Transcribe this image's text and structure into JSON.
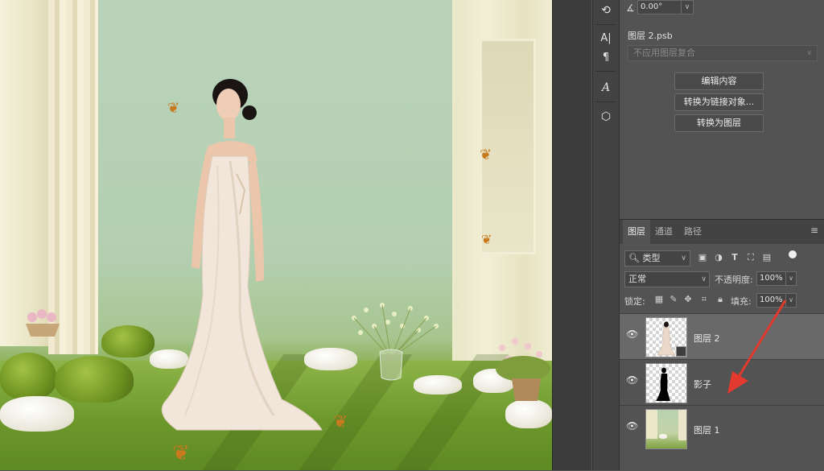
{
  "toolstrip": {
    "tools": [
      "history-icon",
      "character-icon",
      "paragraph-icon",
      "glyphs-icon",
      "3d-icon"
    ]
  },
  "properties": {
    "angle": "0.00°",
    "linked_layer_name": "图层 2.psb",
    "layer_comp_placeholder": "不应用图层复合",
    "buttons": {
      "edit_contents": "编辑内容",
      "convert_to_linked": "转换为链接对象...",
      "convert_to_layers": "转换为图层"
    }
  },
  "layers_panel": {
    "tabs": [
      "图层",
      "通道",
      "路径"
    ],
    "active_tab": "图层",
    "filter": {
      "kind_label": "类型",
      "icons": [
        "image-filter-icon",
        "adjustment-filter-icon",
        "type-filter-icon",
        "shape-filter-icon",
        "smart-object-filter-icon"
      ]
    },
    "blend_mode": "正常",
    "opacity_label": "不透明度:",
    "opacity": "100%",
    "lock_label": "锁定:",
    "fill_label": "填充:",
    "fill": "100%",
    "layers": [
      {
        "name": "图层 2",
        "selected": true,
        "visible": true,
        "type": "smart-object"
      },
      {
        "name": "影子",
        "selected": false,
        "visible": true,
        "type": "pixel"
      },
      {
        "name": "图层 1",
        "selected": false,
        "visible": true,
        "type": "pixel"
      }
    ]
  },
  "colors": {
    "panel_bg": "#535353",
    "selected_row": "#696969",
    "arrow": "#e23a2e"
  }
}
